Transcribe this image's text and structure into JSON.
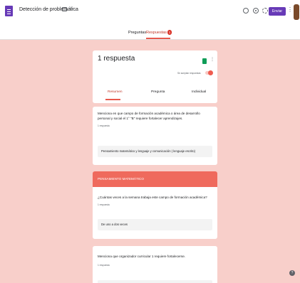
{
  "header": {
    "doc_title": "Detección de problemática",
    "send_label": "Enviar",
    "icons": [
      "forms-doc-icon",
      "folder-icon",
      "star-icon",
      "palette-icon",
      "preview-eye-icon",
      "settings-icon",
      "more-vert-icon",
      "avatar"
    ]
  },
  "tabs": {
    "preguntas": "Preguntas",
    "respuestas": "Respuestas",
    "respuestas_badge": "1"
  },
  "summary": {
    "title": "1 respuesta",
    "accept_label": "Se aceptan respuestas",
    "subtabs": {
      "resumen": "Resumen",
      "pregunta": "Pregunta",
      "individual": "Individual"
    }
  },
  "questions": [
    {
      "title": "Menciona en que campo de formación académica o área de desarrollo personal y social el 1° \"B\" requiere fortalecer aprendizajes.",
      "count": "1 respuesta",
      "answer": "Pensamiento matemático y lenguaje y comunicación ( lenguaje escrito)"
    },
    {
      "title": "¿Cuántas veces a la semana trabaja este campo de formación académica?",
      "count": "1 respuesta",
      "answer": "De uno a dos veces"
    },
    {
      "title": "Menciona que organizador curricular 1 requiere fortalecerse.",
      "count": "1 respuesta",
      "answer": ""
    }
  ],
  "section": {
    "title": "PENSAMIENTO MATEMÁTICO"
  },
  "colors": {
    "background": "#f8cfca",
    "accent": "#ef6a5d",
    "brand": "#673ab7"
  }
}
